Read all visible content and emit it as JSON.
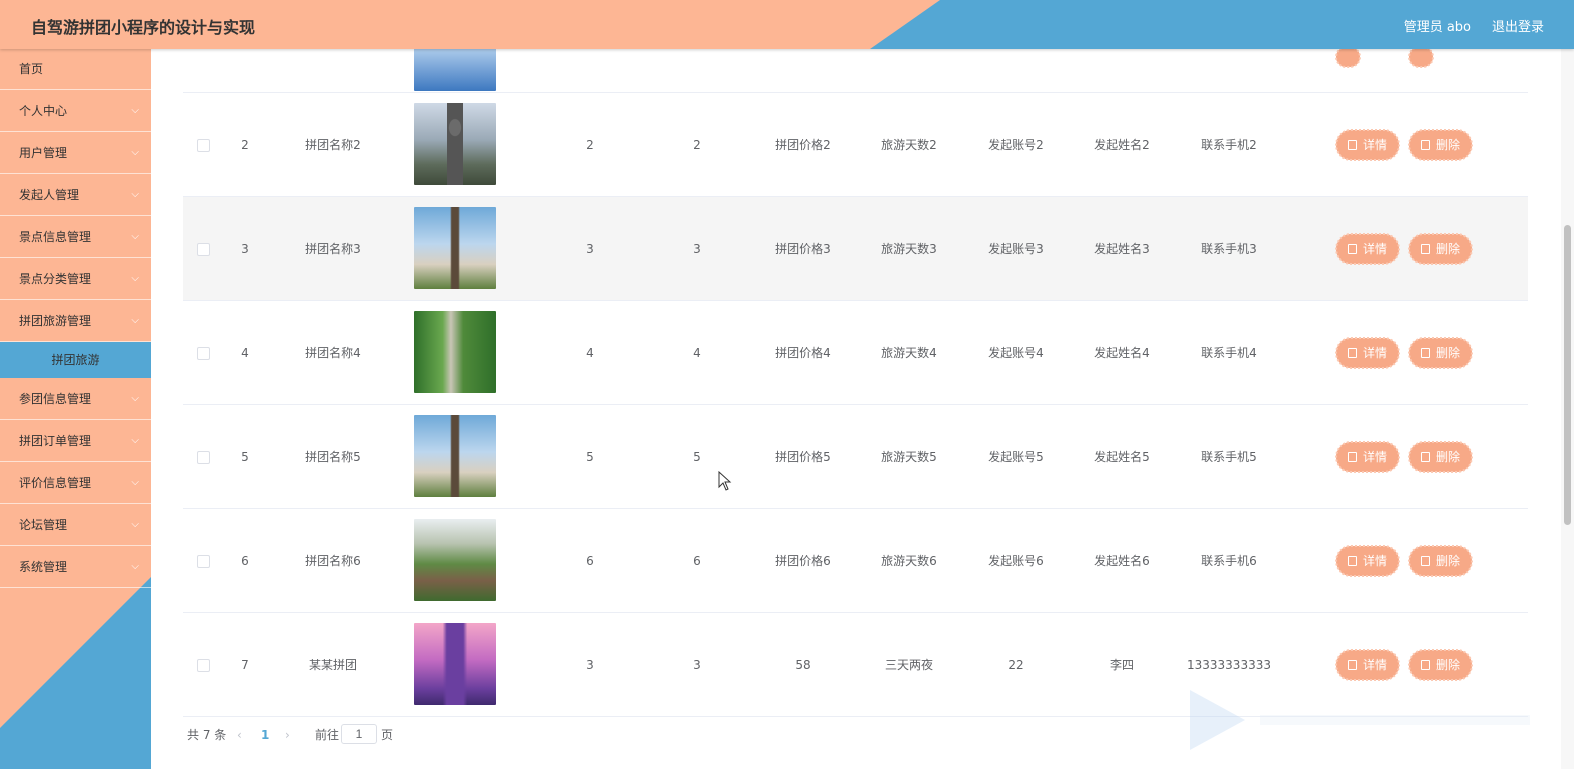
{
  "header": {
    "title": "自驾游拼团小程序的设计与实现",
    "user": "管理员 abo",
    "logout": "退出登录"
  },
  "sidebar": {
    "items": [
      {
        "label": "首页"
      },
      {
        "label": "个人中心"
      },
      {
        "label": "用户管理"
      },
      {
        "label": "发起人管理"
      },
      {
        "label": "景点信息管理"
      },
      {
        "label": "景点分类管理"
      },
      {
        "label": "拼团旅游管理"
      },
      {
        "label": "参团信息管理"
      },
      {
        "label": "拼团订单管理"
      },
      {
        "label": "评价信息管理"
      },
      {
        "label": "论坛管理"
      },
      {
        "label": "系统管理"
      }
    ],
    "active_sub": "拼团旅游",
    "chevron_icon": "chevron-down-icon"
  },
  "table": {
    "rows": [
      {
        "idx": "2",
        "name": "拼团名称2",
        "c1": "2",
        "c2": "2",
        "price": "拼团价格2",
        "days": "旅游天数2",
        "account": "发起账号2",
        "person": "发起姓名2",
        "phone": "联系手机2",
        "img": "monument"
      },
      {
        "idx": "3",
        "name": "拼团名称3",
        "c1": "3",
        "c2": "3",
        "price": "拼团价格3",
        "days": "旅游天数3",
        "account": "发起账号3",
        "person": "发起姓名3",
        "phone": "联系手机3",
        "img": "eiffel"
      },
      {
        "idx": "4",
        "name": "拼团名称4",
        "c1": "4",
        "c2": "4",
        "price": "拼团价格4",
        "days": "旅游天数4",
        "account": "发起账号4",
        "person": "发起姓名4",
        "phone": "联系手机4",
        "img": "cliff"
      },
      {
        "idx": "5",
        "name": "拼团名称5",
        "c1": "5",
        "c2": "5",
        "price": "拼团价格5",
        "days": "旅游天数5",
        "account": "发起账号5",
        "person": "发起姓名5",
        "phone": "联系手机5",
        "img": "eiffel"
      },
      {
        "idx": "6",
        "name": "拼团名称6",
        "c1": "6",
        "c2": "6",
        "price": "拼团价格6",
        "days": "旅游天数6",
        "account": "发起账号6",
        "person": "发起姓名6",
        "phone": "联系手机6",
        "img": "mountain"
      },
      {
        "idx": "7",
        "name": "某某拼团",
        "c1": "3",
        "c2": "3",
        "price": "58",
        "days": "三天两夜",
        "account": "22",
        "person": "李四",
        "phone": "13333333333",
        "img": "castle"
      }
    ],
    "detail_label": "详情",
    "delete_label": "删除"
  },
  "pagination": {
    "total": "共 7 条",
    "current": "1",
    "goto": "前往",
    "page_input": "1",
    "page_suffix": "页"
  },
  "colors": {
    "peach": "#fdb694",
    "blue": "#54a7d4",
    "button": "#f7a987"
  }
}
